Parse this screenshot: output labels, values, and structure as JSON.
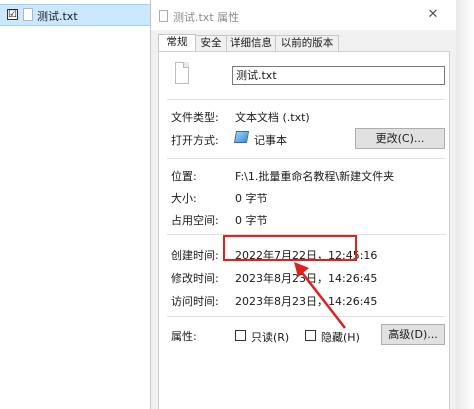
{
  "explorer": {
    "file_name": "测试.txt",
    "checkbox_glyph": "☑"
  },
  "dialog": {
    "title": "测试.txt 属性",
    "close_glyph": "✕",
    "tabs": [
      {
        "label": "常规",
        "active": true
      },
      {
        "label": "安全",
        "active": false
      },
      {
        "label": "详细信息",
        "active": false
      },
      {
        "label": "以前的版本",
        "active": false
      }
    ],
    "file_name_value": "测试.txt",
    "type_label": "文件类型:",
    "type_value": "文本文档 (.txt)",
    "opens_with_label": "打开方式:",
    "opens_with_value": "记事本",
    "change_button": "更改(C)...",
    "location_label": "位置:",
    "location_value": "F:\\1.批量重命名教程\\新建文件夹",
    "size_label": "大小:",
    "size_value": "0 字节",
    "size_on_disk_label": "占用空间:",
    "size_on_disk_value": "0 字节",
    "created_label": "创建时间:",
    "created_value": "2022年7月22日，12:45:16",
    "modified_label": "修改时间:",
    "modified_value": "2023年8月23日，14:26:45",
    "accessed_label": "访问时间:",
    "accessed_value": "2023年8月23日，14:26:45",
    "attributes_label": "属性:",
    "readonly_label": "只读(R)",
    "hidden_label": "隐藏(H)",
    "advanced_button": "高级(D)..."
  },
  "colors": {
    "highlight": "#e02020",
    "selection": "#cce8ff"
  }
}
